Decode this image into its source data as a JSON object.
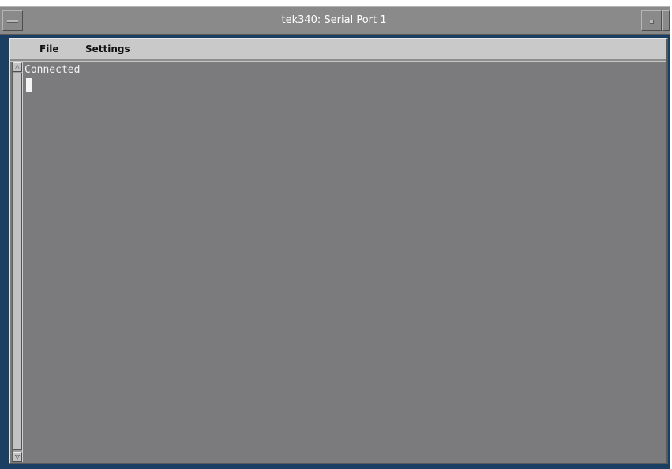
{
  "window": {
    "title": "tek340: Serial Port 1"
  },
  "menubar": {
    "items": [
      {
        "label": "File"
      },
      {
        "label": "Settings"
      }
    ]
  },
  "terminal": {
    "output": "Connected",
    "scrollbar": {
      "up_arrow": "△",
      "down_arrow": "▽"
    }
  },
  "icons": {
    "window_menu": "window-menu-icon",
    "minimize": "minimize-icon",
    "maximize": "maximize-icon",
    "scroll_up": "scroll-up-arrow-icon",
    "scroll_down": "scroll-down-arrow-icon"
  },
  "colors": {
    "title_bar": "#8a8a8a",
    "window_frame": "#1b3f63",
    "menu_bar": "#c9c9c9",
    "terminal_background": "#7b7a7c",
    "terminal_text": "#f2f2f2"
  }
}
